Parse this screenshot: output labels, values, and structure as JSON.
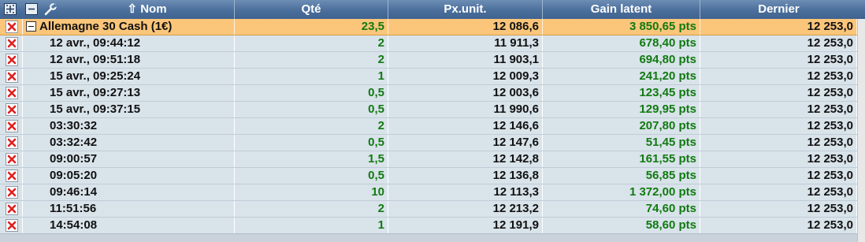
{
  "header": {
    "columns": [
      "Nom",
      "Qté",
      "Px.unit.",
      "Gain latent",
      "Dernier"
    ],
    "sort_arrow": "⇧"
  },
  "icons": {
    "expand_all": "expand-all-icon",
    "collapse_all": "collapse-all-icon",
    "settings": "wrench-icon",
    "delete": "delete-x-icon"
  },
  "colors": {
    "header_bg": "#4b6f9b",
    "group_row_bg": "#fbc67a",
    "detail_row_bg": "#d9e3ea",
    "gain_text": "#117a11",
    "delete_icon": "#e02020"
  },
  "group": {
    "name": "Allemagne 30 Cash (1€)",
    "qty": "23,5",
    "unit_price": "12 086,6",
    "gain": "3 850,65 pts",
    "last": "12 253,0"
  },
  "rows": [
    {
      "time": "12 avr., 09:44:12",
      "qty": "2",
      "unit_price": "11 911,3",
      "gain": "678,40 pts",
      "last": "12 253,0"
    },
    {
      "time": "12 avr., 09:51:18",
      "qty": "2",
      "unit_price": "11 903,1",
      "gain": "694,80 pts",
      "last": "12 253,0"
    },
    {
      "time": "15 avr., 09:25:24",
      "qty": "1",
      "unit_price": "12 009,3",
      "gain": "241,20 pts",
      "last": "12 253,0"
    },
    {
      "time": "15 avr., 09:27:13",
      "qty": "0,5",
      "unit_price": "12 003,6",
      "gain": "123,45 pts",
      "last": "12 253,0"
    },
    {
      "time": "15 avr., 09:37:15",
      "qty": "0,5",
      "unit_price": "11 990,6",
      "gain": "129,95 pts",
      "last": "12 253,0"
    },
    {
      "time": "03:30:32",
      "qty": "2",
      "unit_price": "12 146,6",
      "gain": "207,80 pts",
      "last": "12 253,0"
    },
    {
      "time": "03:32:42",
      "qty": "0,5",
      "unit_price": "12 147,6",
      "gain": "51,45 pts",
      "last": "12 253,0"
    },
    {
      "time": "09:00:57",
      "qty": "1,5",
      "unit_price": "12 142,8",
      "gain": "161,55 pts",
      "last": "12 253,0"
    },
    {
      "time": "09:05:20",
      "qty": "0,5",
      "unit_price": "12 136,8",
      "gain": "56,85 pts",
      "last": "12 253,0"
    },
    {
      "time": "09:46:14",
      "qty": "10",
      "unit_price": "12 113,3",
      "gain": "1 372,00 pts",
      "last": "12 253,0"
    },
    {
      "time": "11:51:56",
      "qty": "2",
      "unit_price": "12 213,2",
      "gain": "74,60 pts",
      "last": "12 253,0"
    },
    {
      "time": "14:54:08",
      "qty": "1",
      "unit_price": "12 191,9",
      "gain": "58,60 pts",
      "last": "12 253,0"
    }
  ]
}
